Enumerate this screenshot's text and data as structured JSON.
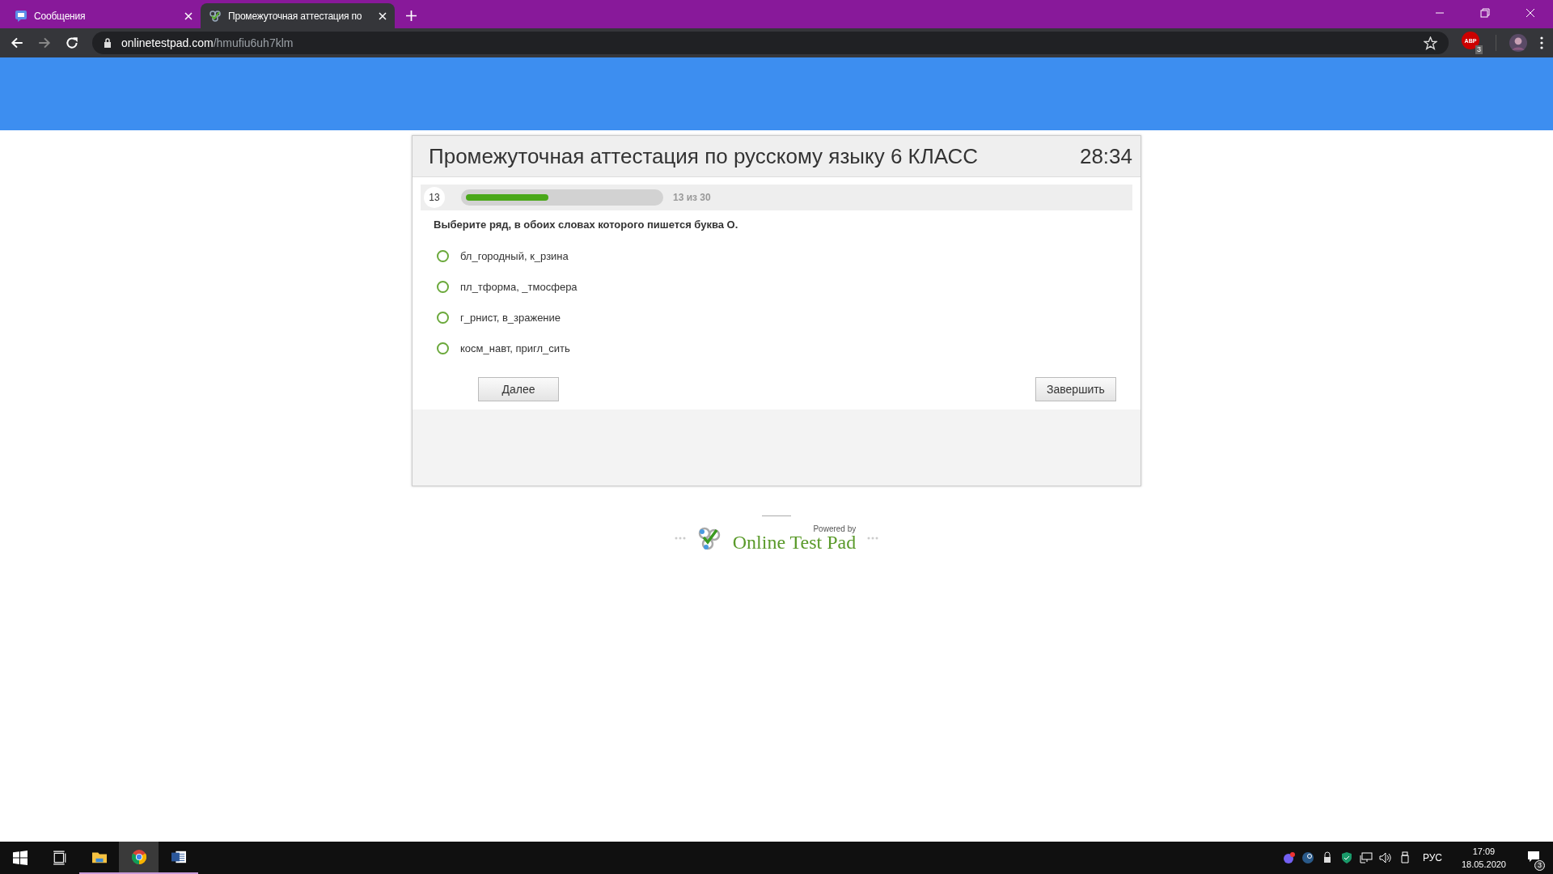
{
  "browser": {
    "tabs": [
      {
        "title": "Сообщения",
        "selected": false,
        "kind": "chat"
      },
      {
        "title": "Промежуточная аттестация по",
        "selected": true,
        "kind": "test"
      }
    ],
    "url": {
      "host": "onlinetestpad.com",
      "path": "/hmufiu6uh7klm"
    },
    "extension": {
      "label": "ABP",
      "badge": "3"
    }
  },
  "test": {
    "title": "Промежуточная аттестация по русскому языку 6 КЛАСС",
    "timer": "28:34",
    "question_number": "13",
    "progress": {
      "level": 0.43,
      "text": "13 из 30"
    },
    "question": "Выберите ряд, в обоих словах которого пишется буква О.",
    "options": [
      {
        "text": "бл_городный, к_рзина",
        "selected": false
      },
      {
        "text": "пл_тформа, _тмосфера",
        "selected": false
      },
      {
        "text": "г_рнист, в_зражение",
        "selected": false
      },
      {
        "text": "косм_навт, пригл_сить",
        "selected": false
      }
    ],
    "next_button": "Далее",
    "finish_button": "Завершить"
  },
  "footer": {
    "powered_by": "Powered by",
    "brand": "Online Test Pad"
  },
  "taskbar": {
    "apps": [
      {
        "kind": "explorer",
        "active": false
      },
      {
        "kind": "chrome",
        "active": true
      },
      {
        "kind": "word",
        "active": false
      }
    ],
    "language": "РУС",
    "time": "17:09",
    "date": "18.05.2020",
    "notifications": "3"
  }
}
